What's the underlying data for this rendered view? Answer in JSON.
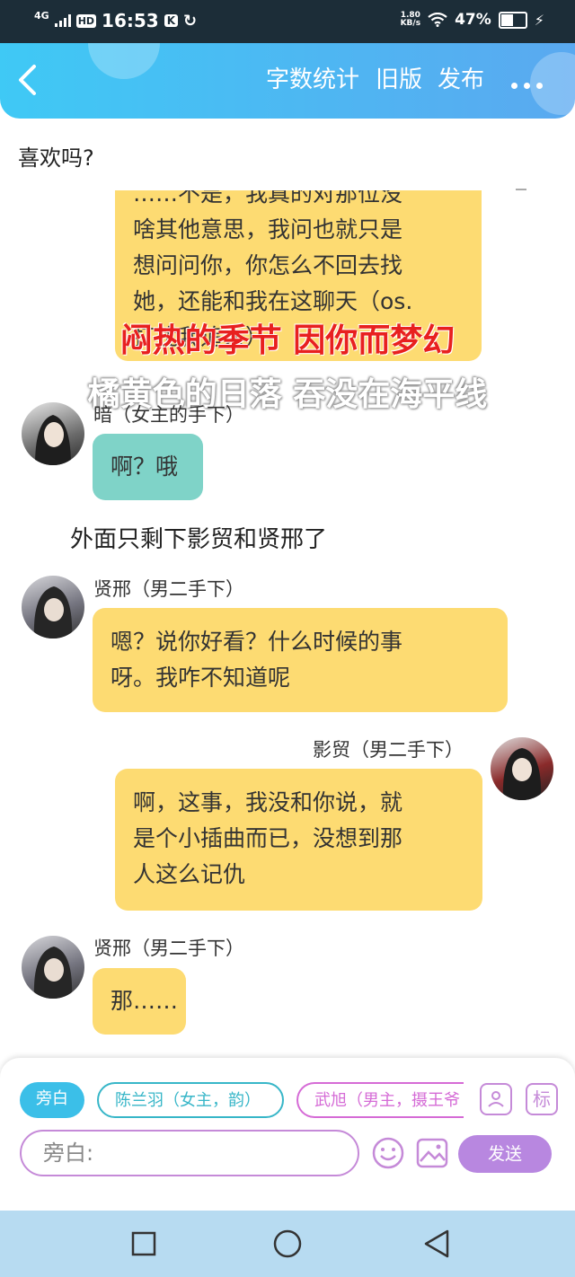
{
  "status_bar": {
    "network": "4G",
    "hd": "HD",
    "time": "16:53",
    "k_badge": "K",
    "speed_value": "1.80",
    "speed_unit": "KB/s",
    "battery": "47%",
    "battery_level": 0.47
  },
  "toolbar": {
    "back_icon": "back-chevron-icon",
    "word_count": "字数统计",
    "old_version": "旧版",
    "publish": "发布",
    "more_icon": "more-dots-icon"
  },
  "chat": {
    "question": "喜欢吗?",
    "truncated_bubble_lines": [
      "……不是，我真的对那位没",
      "啥其他意思，我问也就只是",
      "想问问你，你怎么不回去找",
      "她，还能和我在这聊天（os.",
      "打扰我追人）"
    ],
    "overlay_lyric_1": "闷热的季节 因你而梦幻",
    "overlay_lyric_2": "橘黄色的日落 吞没在海平线",
    "msg1_name": "暗（女主的手下）",
    "msg1_text": "啊？哦",
    "narration": "外面只剩下影贸和贤邢了",
    "msg2_name": "贤邢（男二手下）",
    "msg2_line1": "嗯？说你好看？什么时候的事",
    "msg2_line2": "呀。我咋不知道呢",
    "msg3_name": "影贸（男二手下）",
    "msg3_line1": "啊，这事，我没和你说，就",
    "msg3_line2": "是个小插曲而已，没想到那",
    "msg3_line3": "人这么记仇",
    "msg4_name": "贤邢（男二手下）",
    "msg4_text": "那……"
  },
  "composer": {
    "chip_narrator": "旁白",
    "chip_char1": "陈兰羽（女主，韵）",
    "chip_char2": "武旭（男主，摄王爷",
    "role_icon": "role-card-icon",
    "tag_icon_label": "标",
    "input_placeholder": "旁白:",
    "emoji_icon": "emoji-icon",
    "image_icon": "image-icon",
    "send_label": "发送",
    "colors": {
      "accent": "#b887e0",
      "teal": "#37b6c8",
      "pink": "#d56bd6"
    }
  },
  "nav_bar": {
    "recents_icon": "square-recents-icon",
    "home_icon": "circle-home-icon",
    "back_icon": "triangle-back-icon"
  }
}
